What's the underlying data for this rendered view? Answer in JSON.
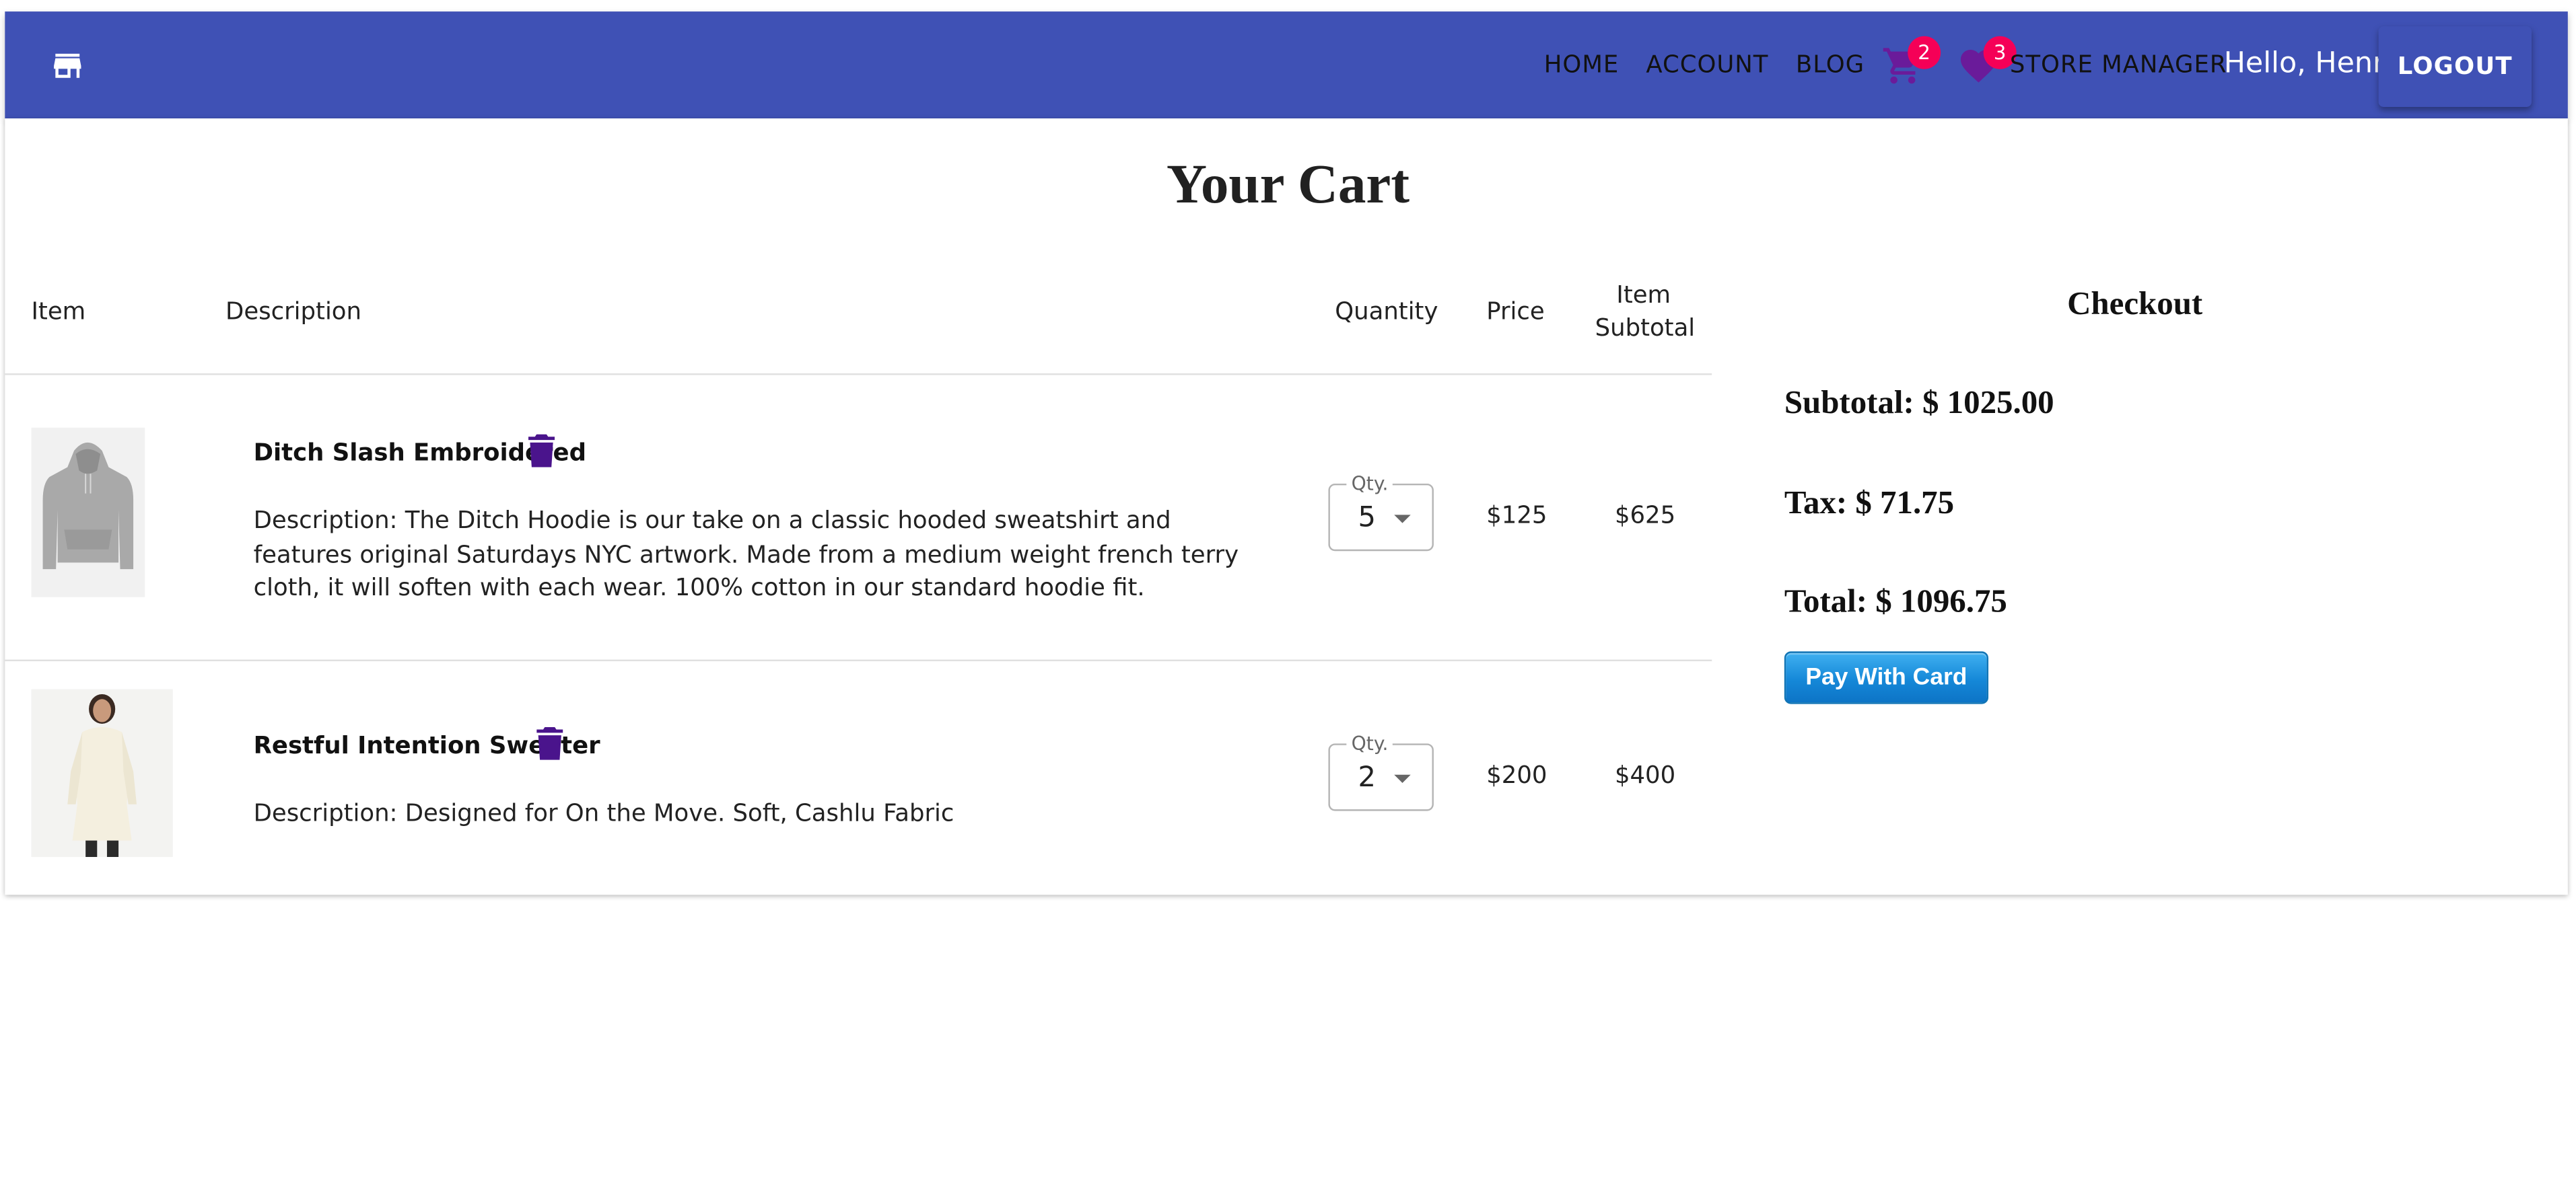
{
  "header": {
    "nav": {
      "home": "HOME",
      "account": "ACCOUNT",
      "blog": "BLOG",
      "store_manager": "STORE MANAGER"
    },
    "cart_badge": "2",
    "wishlist_badge": "3",
    "greeting": "Hello, Henry!",
    "logout_label": "LOGOUT",
    "bar_color": "#3f51b5",
    "badge_color": "#f50057",
    "icons": [
      "store-icon",
      "cart-icon",
      "heart-icon"
    ]
  },
  "cart": {
    "title": "Your Cart",
    "columns": {
      "item": "Item",
      "description": "Description",
      "quantity": "Quantity",
      "price": "Price",
      "subtotal_line1": "Item",
      "subtotal_line2": "Subtotal"
    },
    "items": [
      {
        "name": "Ditch Slash Embroidered",
        "description": "Description: The Ditch Hoodie is our take on a classic hooded sweatshirt and features original Saturdays NYC artwork. Made from a medium weight french terry cloth, it will soften with each wear. 100% cotton in our standard hoodie fit.",
        "qty_label": "Qty.",
        "quantity": "5",
        "price": "$125",
        "subtotal": "$625",
        "image": "grey hoodie"
      },
      {
        "name": "Restful Intention Sweater",
        "description": "Description: Designed for On the Move. Soft, Cashlu Fabric",
        "qty_label": "Qty.",
        "quantity": "2",
        "price": "$200",
        "subtotal": "$400",
        "image": "cream sweater dress"
      }
    ]
  },
  "checkout": {
    "title": "Checkout",
    "subtotal": "Subtotal: $ 1025.00",
    "tax": "Tax: $ 71.75",
    "total": "Total: $ 1096.75",
    "pay_label": "Pay With Card",
    "trash_color": "#4a148c"
  }
}
